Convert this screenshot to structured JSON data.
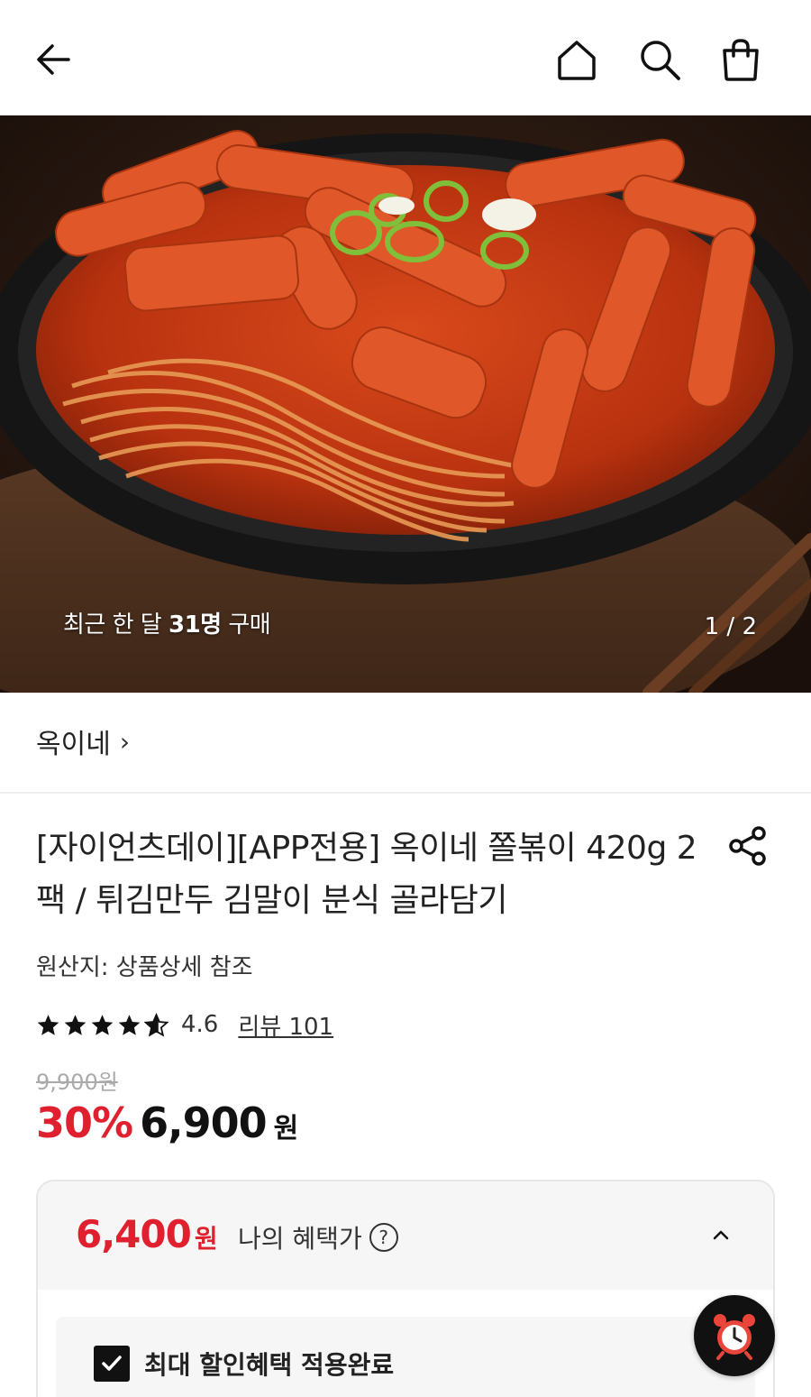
{
  "header": {
    "icons": [
      "back-arrow-icon",
      "home-icon",
      "search-icon",
      "shopping-bag-icon"
    ]
  },
  "hero": {
    "caption_prefix": "최근 한 달 ",
    "caption_count": "31명",
    "caption_suffix": " 구매",
    "counter": "1 / 2"
  },
  "brand": {
    "name": "옥이네",
    "chevron": "›"
  },
  "product": {
    "title": "[자이언츠데이][APP전용] 옥이네 쫄볶이 420g 2팩 / 튀김만두 김말이 분식 골라담기",
    "origin": "원산지: 상품상세 참조",
    "rating": "4.6",
    "rating_value": 4.6,
    "review_link": "리뷰 101",
    "original_price": "9,900원",
    "discount": "30%",
    "sale_price": "6,900",
    "sale_unit": "원"
  },
  "benefit": {
    "price": "6,400",
    "unit": "원",
    "label": "나의 혜택가",
    "help": "?",
    "checkbox_label": "최대 할인혜택 적용완료",
    "checked": true
  },
  "colors": {
    "accent_red": "#e0202e",
    "text_dark": "#222222",
    "muted": "#aaaaaa"
  }
}
